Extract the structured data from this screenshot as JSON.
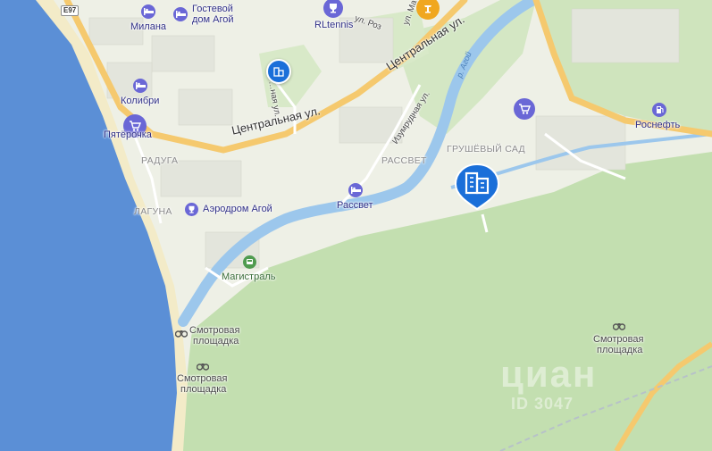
{
  "map": {
    "highway_badge": "E97",
    "colors": {
      "sea": "#5b8fd6",
      "forest": "#c3dfb0",
      "land": "#eef0e6",
      "road_major": "#f5c96e",
      "river": "#9cc7ec",
      "poi_blue": "#5b5fd6",
      "building_pin": "#1a6fd9"
    },
    "streets": {
      "central_1": "Центральная ул.",
      "central_2": "Центральная ул.",
      "izumrudnaya": "Изумрудная ул.",
      "roz": "ул. Роз",
      "ma": "ул. Ма",
      "vertical": "…ная ул.",
      "river_name": "р. Агой"
    },
    "districts": {
      "raduga": "РАДУГА",
      "rassvet": "РАССВЕТ",
      "laguna": "ЛАГУНА",
      "grushevy_sad": "ГРУШЁВЫЙ САД"
    },
    "pois": {
      "milana": "Милана",
      "guesthouse_line1": "Гостевой",
      "guesthouse_line2": "дом Агой",
      "rltennis": "RLtennis",
      "kolibri": "Колибри",
      "pyaterochka": "Пятёрочка",
      "aerodrom": "Аэродром Агой",
      "rassvet_hotel": "Рассвет",
      "magistral": "Магистраль",
      "rosneft": "Роснефть",
      "viewpoint1_line1": "Смотровая",
      "viewpoint1_line2": "площадка",
      "viewpoint2_line1": "Смотровая",
      "viewpoint2_line2": "площадка",
      "viewpoint3_line1": "Смотровая",
      "viewpoint3_line2": "площадка"
    },
    "icons": {
      "hotel": "bed-icon",
      "tennis": "trophy-icon",
      "shop": "cart-icon",
      "aerodrom": "trophy-icon",
      "magistral": "bus-icon",
      "fuel": "fuel-icon",
      "viewpoint": "binoculars-icon",
      "building": "building-icon"
    },
    "watermark_main": "циан",
    "watermark_sub": "ID 3047"
  }
}
